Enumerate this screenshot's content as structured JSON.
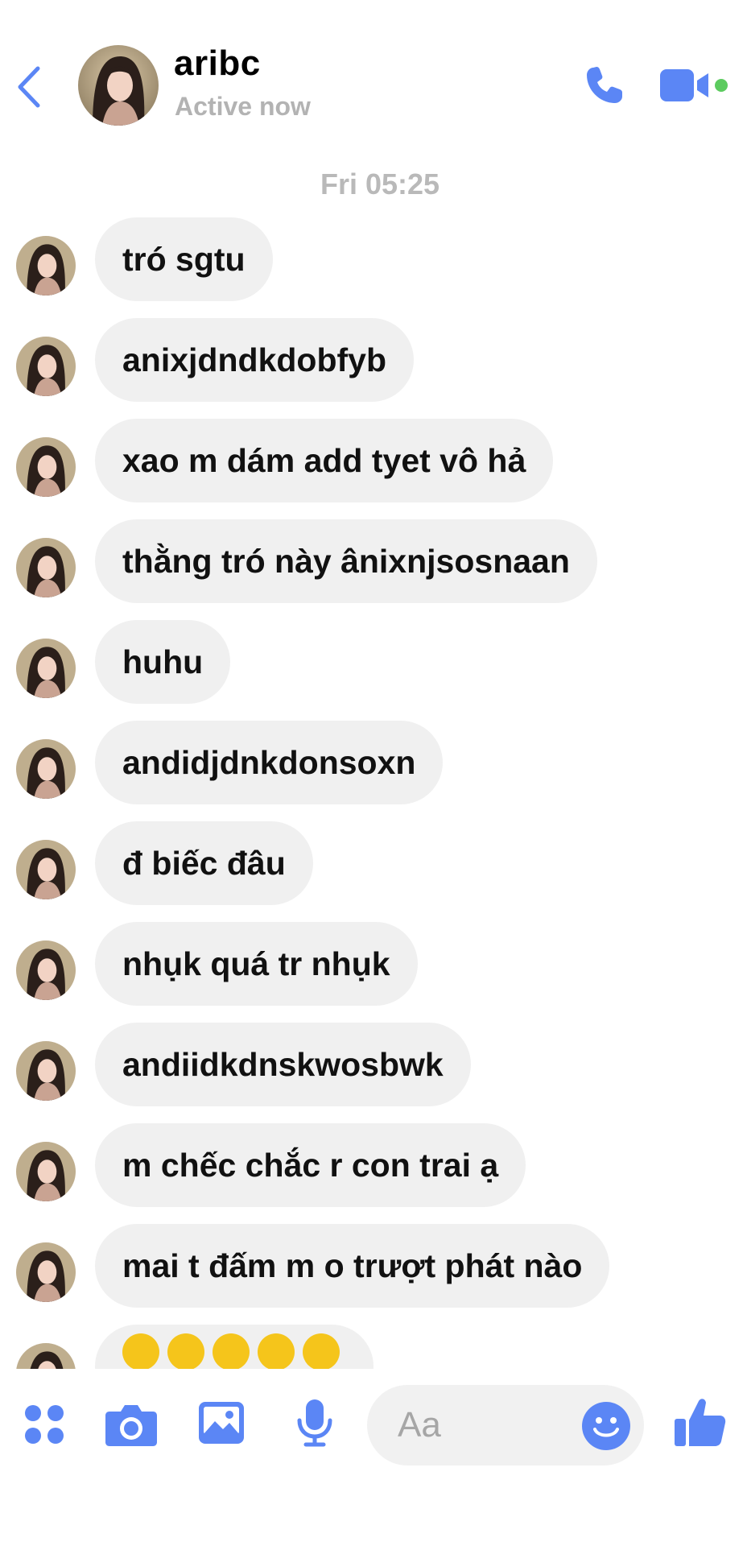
{
  "header": {
    "name": "aribc",
    "status": "Active now",
    "icons": {
      "back": "chevron-left-icon",
      "call": "phone-icon",
      "video": "video-camera-icon"
    },
    "accent_color": "#5b86f5",
    "active_color": "#5ccb5f"
  },
  "conversation": {
    "timestamp": "Fri 05:25",
    "messages": [
      {
        "text": "tró sgtu"
      },
      {
        "text": "anixjdndkdobfyb"
      },
      {
        "text": "xao m dám add tyet vô hả"
      },
      {
        "text": "thằng tró này ânixnjsosnaan"
      },
      {
        "text": "huhu"
      },
      {
        "text": "andidjdnkdonsoxn"
      },
      {
        "text": "đ biếc đâu"
      },
      {
        "text": "nhụk quá tr nhụk"
      },
      {
        "text": "andiidkdnskwosbwk"
      },
      {
        "text": "m chếc chắc r con trai ạ"
      },
      {
        "text": "mai t đấm m o trượt phát nào"
      },
      {
        "text": "",
        "emoji": [
          "neutral-face-icon",
          "neutral-face-icon",
          "neutral-face-icon",
          "neutral-face-icon",
          "neutral-face-icon"
        ]
      }
    ]
  },
  "composer": {
    "placeholder": "Aa",
    "icons": [
      "apps-grid-icon",
      "camera-icon",
      "image-icon",
      "microphone-icon",
      "emoji-icon",
      "thumbs-up-icon"
    ]
  }
}
